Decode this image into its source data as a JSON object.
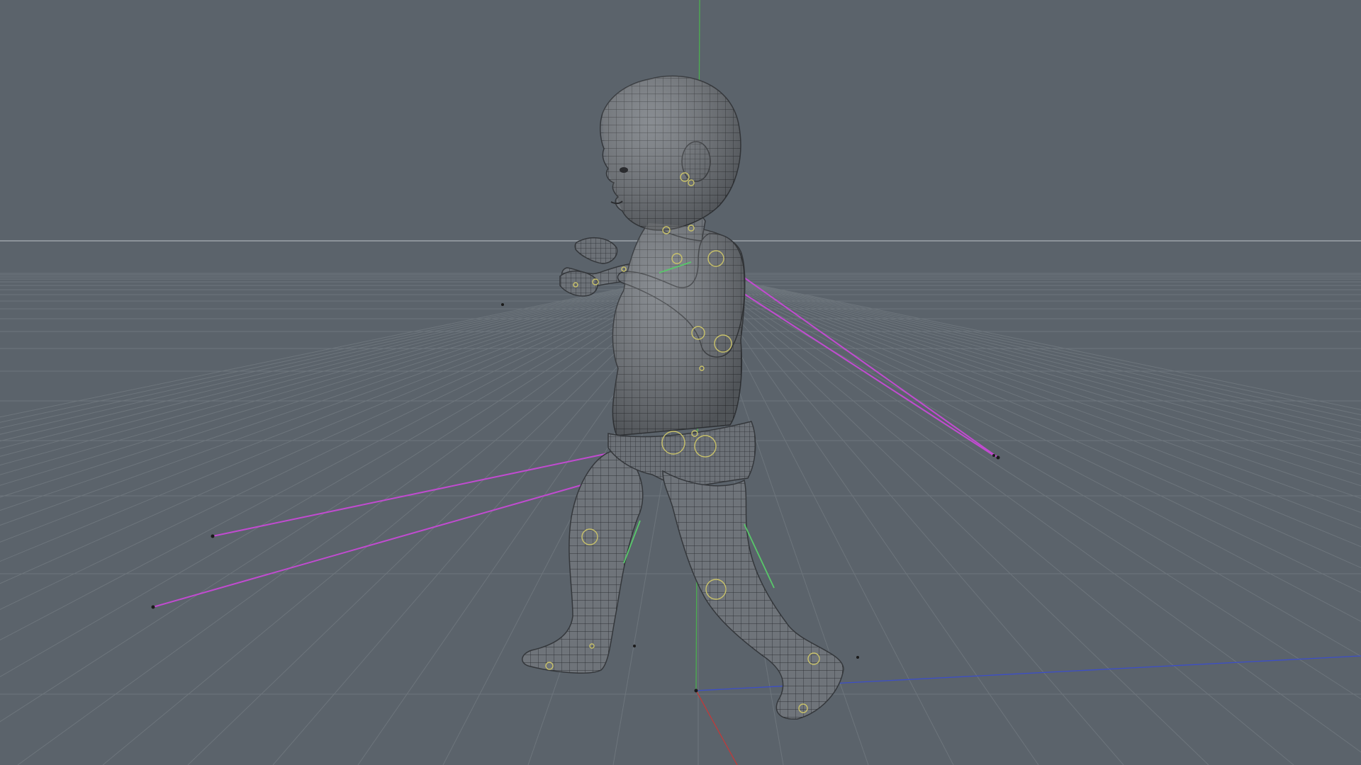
{
  "viewport": {
    "view_type": "perspective",
    "background_color": "#5b636b",
    "grid_color": "#6d757c",
    "horizon_color": "#a9b0b6"
  },
  "axes": {
    "x_axis_color": "#c03a3a",
    "y_axis_color": "#4caf50",
    "z_axis_color": "#3c4ec8"
  },
  "scene": {
    "model": "baby-character-wireframe-mesh",
    "mesh_fill_color": "#6f747a",
    "wire_color": "#2f3236",
    "joint_marker_color": "#c9c26a",
    "ik_goal_line_color": "#c14bd0",
    "ik_pole_line_color": "#58c86a"
  }
}
